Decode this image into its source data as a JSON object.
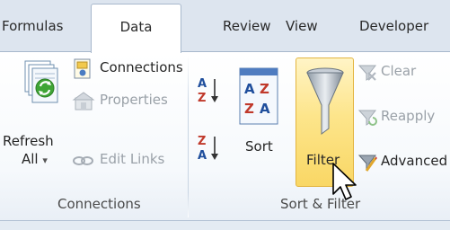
{
  "tabs": [
    {
      "label": "Formulas"
    },
    {
      "label": "Data"
    },
    {
      "label": "Review"
    },
    {
      "label": "View"
    },
    {
      "label": "Developer"
    }
  ],
  "active_tab": "Data",
  "groups": {
    "connections": {
      "label": "Connections",
      "refresh_line1": "Refresh",
      "refresh_line2": "All",
      "refresh_caret": "▾",
      "connections": "Connections",
      "properties": "Properties",
      "edit_links": "Edit Links"
    },
    "sort_filter": {
      "label": "Sort & Filter",
      "sort": "Sort",
      "filter": "Filter",
      "clear": "Clear",
      "reapply": "Reapply",
      "advanced": "Advanced"
    }
  },
  "icons": {
    "refresh": "refresh-icon",
    "connections": "connections-icon",
    "properties": "properties-icon",
    "edit_links": "chain-link-icon",
    "sort_az": "sort-a-to-z-icon",
    "sort_za": "sort-z-to-a-icon",
    "sort": "sort-dialog-icon",
    "filter": "funnel-icon",
    "clear": "clear-filter-icon",
    "reapply": "reapply-filter-icon",
    "advanced": "advanced-filter-icon",
    "cursor": "mouse-pointer-icon"
  },
  "colors": {
    "tabstrip": "#dde5ef",
    "highlight_top": "#fff4c6",
    "highlight_bottom": "#f9d765",
    "refresh_green": "#3fa535",
    "sort_red": "#c0392b",
    "sort_blue": "#1f4e9c"
  }
}
